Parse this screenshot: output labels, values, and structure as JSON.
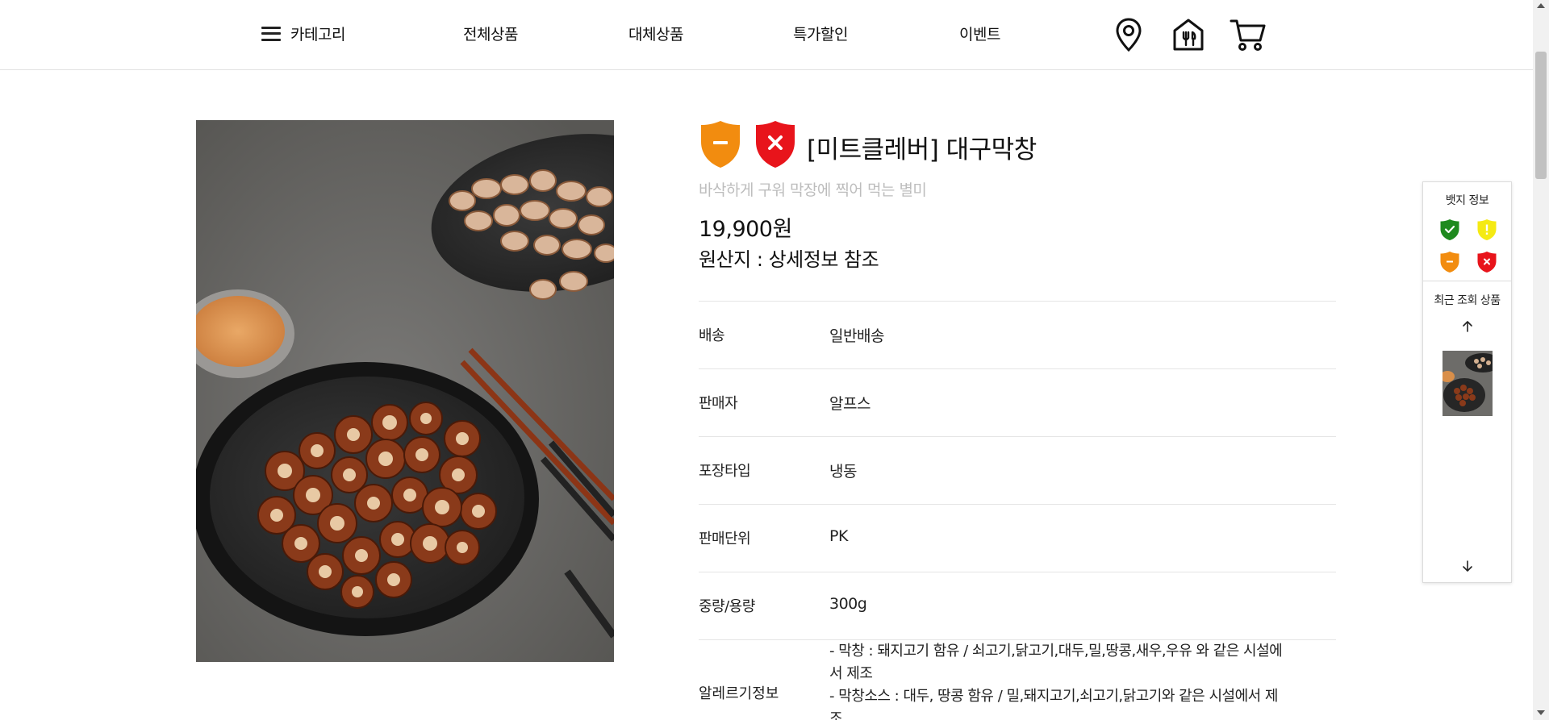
{
  "header": {
    "nav": {
      "category": "카테고리",
      "all_products": "전체상품",
      "substitutes": "대체상품",
      "special_sale": "특가할인",
      "event": "이벤트"
    },
    "icons": [
      "location-pin-icon",
      "store-icon",
      "cart-icon"
    ]
  },
  "product": {
    "badges": [
      {
        "name": "orange-minus-badge",
        "color": "#f28c0f",
        "symbol": "minus"
      },
      {
        "name": "red-x-badge",
        "color": "#e8141b",
        "symbol": "x"
      }
    ],
    "title": "[미트클레버] 대구막창",
    "subtitle": "바삭하게 구워 막장에 찍어 먹는 별미",
    "price": "19,900원",
    "origin": "원산지 : 상세정보 참조",
    "details": [
      {
        "label": "배송",
        "value": "일반배송"
      },
      {
        "label": "판매자",
        "value": "알프스"
      },
      {
        "label": "포장타입",
        "value": "냉동"
      },
      {
        "label": "판매단위",
        "value": "PK"
      },
      {
        "label": "중량/용량",
        "value": "300g"
      }
    ],
    "allergy": {
      "label": "알레르기정보",
      "lines": [
        "- 막창 : 돼지고기 함유 / 쇠고기,닭고기,대두,밀,땅콩,새우,우유 와 같은 시설에",
        "서 제조",
        "- 막창소스 : 대두, 땅콩 함유 / 밀,돼지고기,쇠고기,닭고기와 같은 시설에서 제",
        "조"
      ]
    }
  },
  "side_panel": {
    "badge_title": "뱃지 정보",
    "badge_colors": {
      "green": "#1f8a1f",
      "yellow": "#f5ea13",
      "orange": "#f28c0f",
      "red": "#e8141b"
    },
    "recent_title": "최근 조회 상품"
  }
}
